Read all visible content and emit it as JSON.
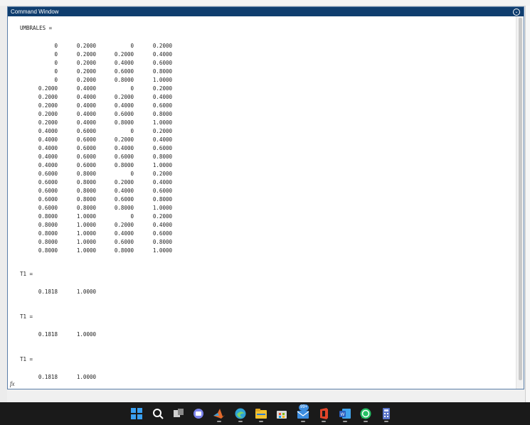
{
  "command_window": {
    "title": "Command Window",
    "menu_icon": "chevron-down-circle-icon"
  },
  "output": {
    "umbrales": {
      "label": "UMBRALES =",
      "rows": [
        [
          "0",
          "0.2000",
          "0",
          "0.2000"
        ],
        [
          "0",
          "0.2000",
          "0.2000",
          "0.4000"
        ],
        [
          "0",
          "0.2000",
          "0.4000",
          "0.6000"
        ],
        [
          "0",
          "0.2000",
          "0.6000",
          "0.8000"
        ],
        [
          "0",
          "0.2000",
          "0.8000",
          "1.0000"
        ],
        [
          "0.2000",
          "0.4000",
          "0",
          "0.2000"
        ],
        [
          "0.2000",
          "0.4000",
          "0.2000",
          "0.4000"
        ],
        [
          "0.2000",
          "0.4000",
          "0.4000",
          "0.6000"
        ],
        [
          "0.2000",
          "0.4000",
          "0.6000",
          "0.8000"
        ],
        [
          "0.2000",
          "0.4000",
          "0.8000",
          "1.0000"
        ],
        [
          "0.4000",
          "0.6000",
          "0",
          "0.2000"
        ],
        [
          "0.4000",
          "0.6000",
          "0.2000",
          "0.4000"
        ],
        [
          "0.4000",
          "0.6000",
          "0.4000",
          "0.6000"
        ],
        [
          "0.4000",
          "0.6000",
          "0.6000",
          "0.8000"
        ],
        [
          "0.4000",
          "0.6000",
          "0.8000",
          "1.0000"
        ],
        [
          "0.6000",
          "0.8000",
          "0",
          "0.2000"
        ],
        [
          "0.6000",
          "0.8000",
          "0.2000",
          "0.4000"
        ],
        [
          "0.6000",
          "0.8000",
          "0.4000",
          "0.6000"
        ],
        [
          "0.6000",
          "0.8000",
          "0.6000",
          "0.8000"
        ],
        [
          "0.6000",
          "0.8000",
          "0.8000",
          "1.0000"
        ],
        [
          "0.8000",
          "1.0000",
          "0",
          "0.2000"
        ],
        [
          "0.8000",
          "1.0000",
          "0.2000",
          "0.4000"
        ],
        [
          "0.8000",
          "1.0000",
          "0.4000",
          "0.6000"
        ],
        [
          "0.8000",
          "1.0000",
          "0.6000",
          "0.8000"
        ],
        [
          "0.8000",
          "1.0000",
          "0.8000",
          "1.0000"
        ]
      ]
    },
    "t1_blocks": [
      {
        "label": "T1 =",
        "values": [
          "0.1818",
          "1.0000"
        ]
      },
      {
        "label": "T1 =",
        "values": [
          "0.1818",
          "1.0000"
        ]
      },
      {
        "label": "T1 =",
        "values": [
          "0.1818",
          "1.0000"
        ]
      }
    ],
    "prompt": "fx"
  },
  "taskbar": {
    "badge": "99+",
    "icons": [
      {
        "name": "windows-start-icon",
        "color": "#3aa0f0"
      },
      {
        "name": "search-icon",
        "color": "#ffffff"
      },
      {
        "name": "task-view-icon",
        "color": "#d0d0d0"
      },
      {
        "name": "teams-chat-icon",
        "color": "#7b83eb"
      },
      {
        "name": "matlab-icon",
        "color": "#e26a2c"
      },
      {
        "name": "edge-icon",
        "color": "#2fa3d6"
      },
      {
        "name": "file-explorer-icon",
        "color": "#f2c230"
      },
      {
        "name": "microsoft-store-icon",
        "color": "#d8d8d8"
      },
      {
        "name": "mail-icon",
        "color": "#3c8de0"
      },
      {
        "name": "office-icon",
        "color": "#e1452a"
      },
      {
        "name": "word-icon",
        "color": "#2b5fbf"
      },
      {
        "name": "whatsapp-icon",
        "color": "#26c165"
      },
      {
        "name": "calculator-icon",
        "color": "#5a74c9"
      }
    ]
  }
}
